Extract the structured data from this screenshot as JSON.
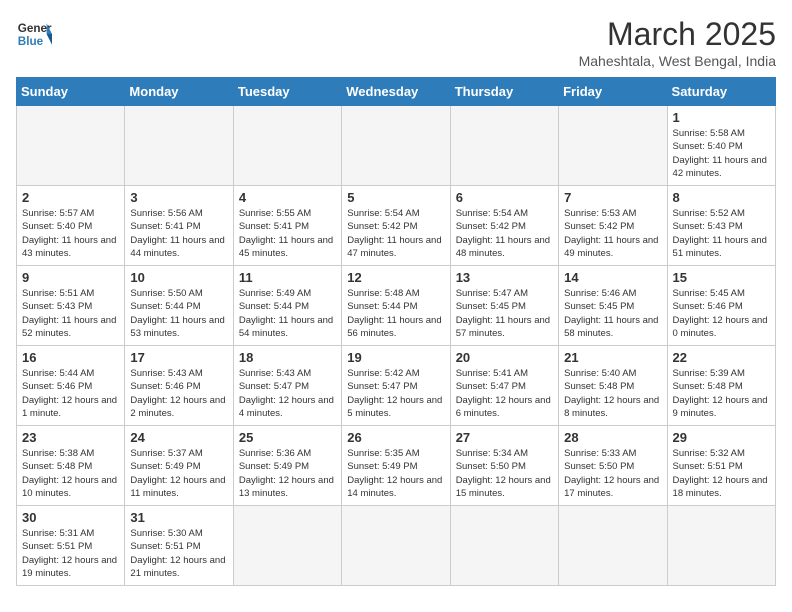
{
  "header": {
    "logo_general": "General",
    "logo_blue": "Blue",
    "title": "March 2025",
    "subtitle": "Maheshtala, West Bengal, India"
  },
  "days_of_week": [
    "Sunday",
    "Monday",
    "Tuesday",
    "Wednesday",
    "Thursday",
    "Friday",
    "Saturday"
  ],
  "weeks": [
    [
      {
        "day": "",
        "info": "",
        "empty": true
      },
      {
        "day": "",
        "info": "",
        "empty": true
      },
      {
        "day": "",
        "info": "",
        "empty": true
      },
      {
        "day": "",
        "info": "",
        "empty": true
      },
      {
        "day": "",
        "info": "",
        "empty": true
      },
      {
        "day": "",
        "info": "",
        "empty": true
      },
      {
        "day": "1",
        "info": "Sunrise: 5:58 AM\nSunset: 5:40 PM\nDaylight: 11 hours\nand 42 minutes."
      }
    ],
    [
      {
        "day": "2",
        "info": "Sunrise: 5:57 AM\nSunset: 5:40 PM\nDaylight: 11 hours\nand 43 minutes."
      },
      {
        "day": "3",
        "info": "Sunrise: 5:56 AM\nSunset: 5:41 PM\nDaylight: 11 hours\nand 44 minutes."
      },
      {
        "day": "4",
        "info": "Sunrise: 5:55 AM\nSunset: 5:41 PM\nDaylight: 11 hours\nand 45 minutes."
      },
      {
        "day": "5",
        "info": "Sunrise: 5:54 AM\nSunset: 5:42 PM\nDaylight: 11 hours\nand 47 minutes."
      },
      {
        "day": "6",
        "info": "Sunrise: 5:54 AM\nSunset: 5:42 PM\nDaylight: 11 hours\nand 48 minutes."
      },
      {
        "day": "7",
        "info": "Sunrise: 5:53 AM\nSunset: 5:42 PM\nDaylight: 11 hours\nand 49 minutes."
      },
      {
        "day": "8",
        "info": "Sunrise: 5:52 AM\nSunset: 5:43 PM\nDaylight: 11 hours\nand 51 minutes."
      }
    ],
    [
      {
        "day": "9",
        "info": "Sunrise: 5:51 AM\nSunset: 5:43 PM\nDaylight: 11 hours\nand 52 minutes."
      },
      {
        "day": "10",
        "info": "Sunrise: 5:50 AM\nSunset: 5:44 PM\nDaylight: 11 hours\nand 53 minutes."
      },
      {
        "day": "11",
        "info": "Sunrise: 5:49 AM\nSunset: 5:44 PM\nDaylight: 11 hours\nand 54 minutes."
      },
      {
        "day": "12",
        "info": "Sunrise: 5:48 AM\nSunset: 5:44 PM\nDaylight: 11 hours\nand 56 minutes."
      },
      {
        "day": "13",
        "info": "Sunrise: 5:47 AM\nSunset: 5:45 PM\nDaylight: 11 hours\nand 57 minutes."
      },
      {
        "day": "14",
        "info": "Sunrise: 5:46 AM\nSunset: 5:45 PM\nDaylight: 11 hours\nand 58 minutes."
      },
      {
        "day": "15",
        "info": "Sunrise: 5:45 AM\nSunset: 5:46 PM\nDaylight: 12 hours\nand 0 minutes."
      }
    ],
    [
      {
        "day": "16",
        "info": "Sunrise: 5:44 AM\nSunset: 5:46 PM\nDaylight: 12 hours\nand 1 minute."
      },
      {
        "day": "17",
        "info": "Sunrise: 5:43 AM\nSunset: 5:46 PM\nDaylight: 12 hours\nand 2 minutes."
      },
      {
        "day": "18",
        "info": "Sunrise: 5:43 AM\nSunset: 5:47 PM\nDaylight: 12 hours\nand 4 minutes."
      },
      {
        "day": "19",
        "info": "Sunrise: 5:42 AM\nSunset: 5:47 PM\nDaylight: 12 hours\nand 5 minutes."
      },
      {
        "day": "20",
        "info": "Sunrise: 5:41 AM\nSunset: 5:47 PM\nDaylight: 12 hours\nand 6 minutes."
      },
      {
        "day": "21",
        "info": "Sunrise: 5:40 AM\nSunset: 5:48 PM\nDaylight: 12 hours\nand 8 minutes."
      },
      {
        "day": "22",
        "info": "Sunrise: 5:39 AM\nSunset: 5:48 PM\nDaylight: 12 hours\nand 9 minutes."
      }
    ],
    [
      {
        "day": "23",
        "info": "Sunrise: 5:38 AM\nSunset: 5:48 PM\nDaylight: 12 hours\nand 10 minutes."
      },
      {
        "day": "24",
        "info": "Sunrise: 5:37 AM\nSunset: 5:49 PM\nDaylight: 12 hours\nand 11 minutes."
      },
      {
        "day": "25",
        "info": "Sunrise: 5:36 AM\nSunset: 5:49 PM\nDaylight: 12 hours\nand 13 minutes."
      },
      {
        "day": "26",
        "info": "Sunrise: 5:35 AM\nSunset: 5:49 PM\nDaylight: 12 hours\nand 14 minutes."
      },
      {
        "day": "27",
        "info": "Sunrise: 5:34 AM\nSunset: 5:50 PM\nDaylight: 12 hours\nand 15 minutes."
      },
      {
        "day": "28",
        "info": "Sunrise: 5:33 AM\nSunset: 5:50 PM\nDaylight: 12 hours\nand 17 minutes."
      },
      {
        "day": "29",
        "info": "Sunrise: 5:32 AM\nSunset: 5:51 PM\nDaylight: 12 hours\nand 18 minutes."
      }
    ],
    [
      {
        "day": "30",
        "info": "Sunrise: 5:31 AM\nSunset: 5:51 PM\nDaylight: 12 hours\nand 19 minutes."
      },
      {
        "day": "31",
        "info": "Sunrise: 5:30 AM\nSunset: 5:51 PM\nDaylight: 12 hours\nand 21 minutes."
      },
      {
        "day": "",
        "info": "",
        "empty": true
      },
      {
        "day": "",
        "info": "",
        "empty": true
      },
      {
        "day": "",
        "info": "",
        "empty": true
      },
      {
        "day": "",
        "info": "",
        "empty": true
      },
      {
        "day": "",
        "info": "",
        "empty": true
      }
    ]
  ]
}
